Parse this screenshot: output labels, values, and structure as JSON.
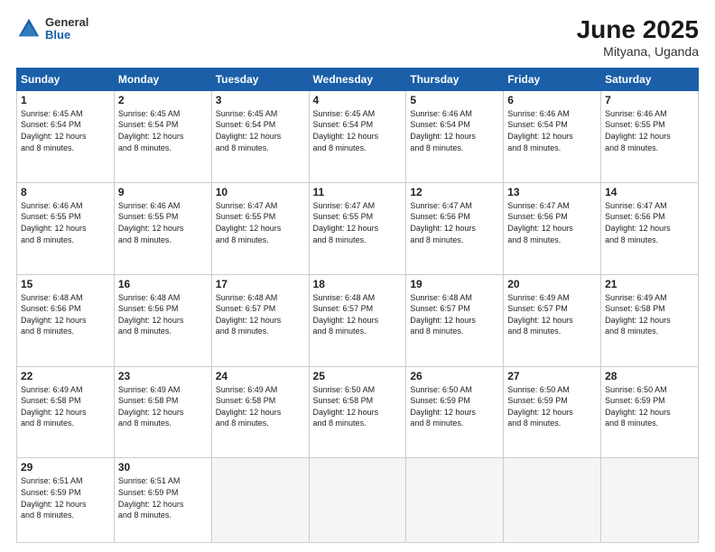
{
  "header": {
    "logo_general": "General",
    "logo_blue": "Blue",
    "month_title": "June 2025",
    "location": "Mityana, Uganda"
  },
  "days_of_week": [
    "Sunday",
    "Monday",
    "Tuesday",
    "Wednesday",
    "Thursday",
    "Friday",
    "Saturday"
  ],
  "weeks": [
    [
      {
        "day": "1",
        "sunrise": "6:45 AM",
        "sunset": "6:54 PM",
        "daylight": "12 hours and 8 minutes."
      },
      {
        "day": "2",
        "sunrise": "6:45 AM",
        "sunset": "6:54 PM",
        "daylight": "12 hours and 8 minutes."
      },
      {
        "day": "3",
        "sunrise": "6:45 AM",
        "sunset": "6:54 PM",
        "daylight": "12 hours and 8 minutes."
      },
      {
        "day": "4",
        "sunrise": "6:45 AM",
        "sunset": "6:54 PM",
        "daylight": "12 hours and 8 minutes."
      },
      {
        "day": "5",
        "sunrise": "6:46 AM",
        "sunset": "6:54 PM",
        "daylight": "12 hours and 8 minutes."
      },
      {
        "day": "6",
        "sunrise": "6:46 AM",
        "sunset": "6:54 PM",
        "daylight": "12 hours and 8 minutes."
      },
      {
        "day": "7",
        "sunrise": "6:46 AM",
        "sunset": "6:55 PM",
        "daylight": "12 hours and 8 minutes."
      }
    ],
    [
      {
        "day": "8",
        "sunrise": "6:46 AM",
        "sunset": "6:55 PM",
        "daylight": "12 hours and 8 minutes."
      },
      {
        "day": "9",
        "sunrise": "6:46 AM",
        "sunset": "6:55 PM",
        "daylight": "12 hours and 8 minutes."
      },
      {
        "day": "10",
        "sunrise": "6:47 AM",
        "sunset": "6:55 PM",
        "daylight": "12 hours and 8 minutes."
      },
      {
        "day": "11",
        "sunrise": "6:47 AM",
        "sunset": "6:55 PM",
        "daylight": "12 hours and 8 minutes."
      },
      {
        "day": "12",
        "sunrise": "6:47 AM",
        "sunset": "6:56 PM",
        "daylight": "12 hours and 8 minutes."
      },
      {
        "day": "13",
        "sunrise": "6:47 AM",
        "sunset": "6:56 PM",
        "daylight": "12 hours and 8 minutes."
      },
      {
        "day": "14",
        "sunrise": "6:47 AM",
        "sunset": "6:56 PM",
        "daylight": "12 hours and 8 minutes."
      }
    ],
    [
      {
        "day": "15",
        "sunrise": "6:48 AM",
        "sunset": "6:56 PM",
        "daylight": "12 hours and 8 minutes."
      },
      {
        "day": "16",
        "sunrise": "6:48 AM",
        "sunset": "6:56 PM",
        "daylight": "12 hours and 8 minutes."
      },
      {
        "day": "17",
        "sunrise": "6:48 AM",
        "sunset": "6:57 PM",
        "daylight": "12 hours and 8 minutes."
      },
      {
        "day": "18",
        "sunrise": "6:48 AM",
        "sunset": "6:57 PM",
        "daylight": "12 hours and 8 minutes."
      },
      {
        "day": "19",
        "sunrise": "6:48 AM",
        "sunset": "6:57 PM",
        "daylight": "12 hours and 8 minutes."
      },
      {
        "day": "20",
        "sunrise": "6:49 AM",
        "sunset": "6:57 PM",
        "daylight": "12 hours and 8 minutes."
      },
      {
        "day": "21",
        "sunrise": "6:49 AM",
        "sunset": "6:58 PM",
        "daylight": "12 hours and 8 minutes."
      }
    ],
    [
      {
        "day": "22",
        "sunrise": "6:49 AM",
        "sunset": "6:58 PM",
        "daylight": "12 hours and 8 minutes."
      },
      {
        "day": "23",
        "sunrise": "6:49 AM",
        "sunset": "6:58 PM",
        "daylight": "12 hours and 8 minutes."
      },
      {
        "day": "24",
        "sunrise": "6:49 AM",
        "sunset": "6:58 PM",
        "daylight": "12 hours and 8 minutes."
      },
      {
        "day": "25",
        "sunrise": "6:50 AM",
        "sunset": "6:58 PM",
        "daylight": "12 hours and 8 minutes."
      },
      {
        "day": "26",
        "sunrise": "6:50 AM",
        "sunset": "6:59 PM",
        "daylight": "12 hours and 8 minutes."
      },
      {
        "day": "27",
        "sunrise": "6:50 AM",
        "sunset": "6:59 PM",
        "daylight": "12 hours and 8 minutes."
      },
      {
        "day": "28",
        "sunrise": "6:50 AM",
        "sunset": "6:59 PM",
        "daylight": "12 hours and 8 minutes."
      }
    ],
    [
      {
        "day": "29",
        "sunrise": "6:51 AM",
        "sunset": "6:59 PM",
        "daylight": "12 hours and 8 minutes."
      },
      {
        "day": "30",
        "sunrise": "6:51 AM",
        "sunset": "6:59 PM",
        "daylight": "12 hours and 8 minutes."
      },
      null,
      null,
      null,
      null,
      null
    ]
  ],
  "labels": {
    "sunrise": "Sunrise:",
    "sunset": "Sunset:",
    "daylight": "Daylight:"
  }
}
